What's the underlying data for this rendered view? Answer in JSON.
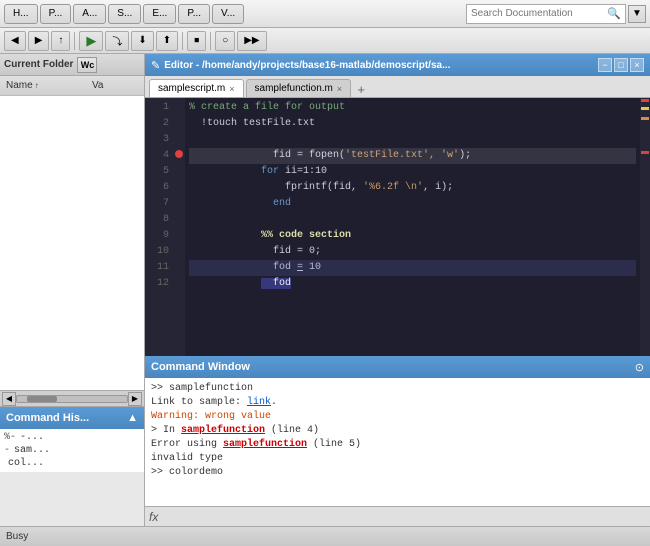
{
  "toolbar": {
    "tabs": [
      {
        "label": "H...",
        "id": "home"
      },
      {
        "label": "P...",
        "id": "plots"
      },
      {
        "label": "A...",
        "id": "apps"
      },
      {
        "label": "S...",
        "id": "shortcuts"
      },
      {
        "label": "E...",
        "id": "editor"
      },
      {
        "label": "P...",
        "id": "publish"
      },
      {
        "label": "V...",
        "id": "view"
      }
    ],
    "search_placeholder": "Search Documentation",
    "search_value": ""
  },
  "current_folder": {
    "label": "Current Folder",
    "btn_label": "Wc"
  },
  "file_table": {
    "col_name": "Name",
    "col_val": "Va",
    "sort_indicator": "↑"
  },
  "cmd_history": {
    "title": "Command His...",
    "items": [
      {
        "dash": "%-",
        "text": "-..."
      },
      {
        "dash": "-",
        "text": "sam..."
      },
      {
        "dash": "",
        "text": "col..."
      }
    ]
  },
  "editor": {
    "title": "Editor - /home/andy/projects/base16-matlab/demoscript/sa...",
    "tabs": [
      {
        "label": "samplescript.m",
        "active": true
      },
      {
        "label": "samplefunction.m",
        "active": false
      }
    ],
    "lines": [
      {
        "num": 1,
        "bp": false,
        "content": "comment",
        "text": "% create a file for output"
      },
      {
        "num": 2,
        "bp": false,
        "content": "normal",
        "text": "  !touch testFile.txt"
      },
      {
        "num": 3,
        "bp": false,
        "content": "code",
        "text": "  fid = fopen('testFile.txt', 'w');"
      },
      {
        "num": 4,
        "bp": true,
        "content": "for",
        "text": "for ii=1:10"
      },
      {
        "num": 5,
        "bp": false,
        "content": "fprintf",
        "text": "    fprintf(fid, '%6.2f \\n', i);"
      },
      {
        "num": 6,
        "bp": false,
        "content": "end",
        "text": "  end"
      },
      {
        "num": 7,
        "bp": false,
        "content": "blank",
        "text": ""
      },
      {
        "num": 8,
        "bp": false,
        "content": "section",
        "text": "%% code section"
      },
      {
        "num": 9,
        "bp": false,
        "content": "fid0",
        "text": "  fid = 0;"
      },
      {
        "num": 10,
        "bp": false,
        "content": "fod10",
        "text": "  fod = 10"
      },
      {
        "num": 11,
        "bp": false,
        "content": "fod",
        "text": "  fod"
      },
      {
        "num": 12,
        "bp": false,
        "content": "blank",
        "text": ""
      }
    ]
  },
  "command_window": {
    "title": "Command Window",
    "lines": [
      {
        "type": "prompt",
        "text": ">> samplefunction"
      },
      {
        "type": "link",
        "prefix": "Link to sample: ",
        "link": "link",
        "suffix": "."
      },
      {
        "type": "warning",
        "text": "Warning: wrong value"
      },
      {
        "type": "in",
        "text": "> In samplefunction (line 4)"
      },
      {
        "type": "error",
        "prefix": "Error using ",
        "func": "samplefunction",
        "suffix": " (line 5)"
      },
      {
        "type": "invalid",
        "text": "invalid type"
      },
      {
        "type": "prompt2",
        "text": ">> colordemo"
      }
    ],
    "fx_label": "fx"
  },
  "status_bar": {
    "text": "Busy"
  }
}
